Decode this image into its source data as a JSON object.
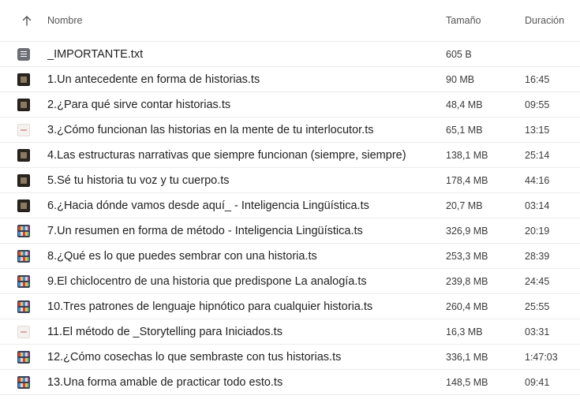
{
  "header": {
    "name": "Nombre",
    "size": "Tamaño",
    "duration": "Duración"
  },
  "files": [
    {
      "name": "_IMPORTANTE.txt",
      "size": "605 B",
      "duration": "",
      "icon": "text-file-icon",
      "thumb": "txt"
    },
    {
      "name": "1.Un antecedente en forma de historias.ts",
      "size": "90 MB",
      "duration": "16:45",
      "icon": "video-thumbnail-icon",
      "thumb": "dark"
    },
    {
      "name": "2.¿Para qué sirve contar historias.ts",
      "size": "48,4 MB",
      "duration": "09:55",
      "icon": "video-thumbnail-icon",
      "thumb": "dark"
    },
    {
      "name": "3.¿Cómo funcionan las historias en la mente de tu interlocutor.ts",
      "size": "65,1 MB",
      "duration": "13:15",
      "icon": "video-thumbnail-icon",
      "thumb": "light"
    },
    {
      "name": "4.Las estructuras narrativas que siempre funcionan (siempre, siempre)",
      "size": "138,1 MB",
      "duration": "25:14",
      "icon": "video-thumbnail-icon",
      "thumb": "dark"
    },
    {
      "name": "5.Sé tu historia tu voz y tu cuerpo.ts",
      "size": "178,4 MB",
      "duration": "44:16",
      "icon": "video-thumbnail-icon",
      "thumb": "dark"
    },
    {
      "name": "6.¿Hacia dónde vamos desde aquí_ - Inteligencia Lingüística.ts",
      "size": "20,7 MB",
      "duration": "03:14",
      "icon": "video-thumbnail-icon",
      "thumb": "dark"
    },
    {
      "name": "7.Un resumen en forma de método - Inteligencia Lingüística.ts",
      "size": "326,9 MB",
      "duration": "20:19",
      "icon": "video-thumbnail-icon",
      "thumb": "shelf"
    },
    {
      "name": "8.¿Qué es lo que puedes sembrar con una historia.ts",
      "size": "253,3 MB",
      "duration": "28:39",
      "icon": "video-thumbnail-icon",
      "thumb": "shelf"
    },
    {
      "name": "9.El chiclocentro de una historia que predispone La analogía.ts",
      "size": "239,8 MB",
      "duration": "24:45",
      "icon": "video-thumbnail-icon",
      "thumb": "shelf"
    },
    {
      "name": "10.Tres patrones de lenguaje hipnótico para cualquier historia.ts",
      "size": "260,4 MB",
      "duration": "25:55",
      "icon": "video-thumbnail-icon",
      "thumb": "shelf"
    },
    {
      "name": "11.El método de _Storytelling para Iniciados.ts",
      "size": "16,3 MB",
      "duration": "03:31",
      "icon": "video-thumbnail-icon",
      "thumb": "light"
    },
    {
      "name": "12.¿Cómo cosechas lo que sembraste con tus historias.ts",
      "size": "336,1 MB",
      "duration": "1:47:03",
      "icon": "video-thumbnail-icon",
      "thumb": "shelf"
    },
    {
      "name": "13.Una forma amable de practicar todo esto.ts",
      "size": "148,5 MB",
      "duration": "09:41",
      "icon": "video-thumbnail-icon",
      "thumb": "shelf"
    }
  ]
}
